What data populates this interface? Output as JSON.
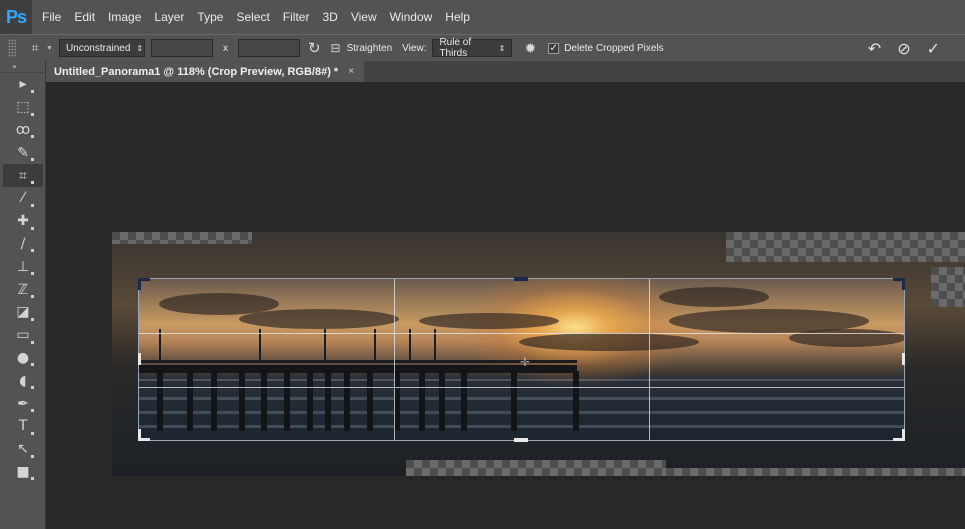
{
  "app": {
    "logo": "Ps"
  },
  "menu": [
    "File",
    "Edit",
    "Image",
    "Layer",
    "Type",
    "Select",
    "Filter",
    "3D",
    "View",
    "Window",
    "Help"
  ],
  "options": {
    "ratio_preset": "Unconstrained",
    "width_value": "",
    "height_value": "",
    "x_label": "x",
    "straighten_label": "Straighten",
    "view_label": "View:",
    "view_value": "Rule of Thirds",
    "delete_cropped_label": "Delete Cropped Pixels",
    "delete_cropped_checked": true
  },
  "document": {
    "tab_title": "Untitled_Panorama1 @ 118% (Crop Preview, RGB/8#) *",
    "close_glyph": "×"
  },
  "tools": [
    {
      "name": "move-tool-icon",
      "glyph": "▸"
    },
    {
      "name": "marquee-tool-icon",
      "glyph": "⬚"
    },
    {
      "name": "lasso-tool-icon",
      "glyph": "ꝏ"
    },
    {
      "name": "quick-selection-tool-icon",
      "glyph": "✎"
    },
    {
      "name": "crop-tool-icon",
      "glyph": "⌗"
    },
    {
      "name": "eyedropper-tool-icon",
      "glyph": "⁄"
    },
    {
      "name": "healing-brush-tool-icon",
      "glyph": "✚"
    },
    {
      "name": "brush-tool-icon",
      "glyph": "∕"
    },
    {
      "name": "clone-stamp-tool-icon",
      "glyph": "⊥"
    },
    {
      "name": "history-brush-tool-icon",
      "glyph": "ℤ"
    },
    {
      "name": "eraser-tool-icon",
      "glyph": "◪"
    },
    {
      "name": "gradient-tool-icon",
      "glyph": "▭"
    },
    {
      "name": "blur-tool-icon",
      "glyph": "●"
    },
    {
      "name": "dodge-tool-icon",
      "glyph": "◖"
    },
    {
      "name": "pen-tool-icon",
      "glyph": "✒"
    },
    {
      "name": "type-tool-icon",
      "glyph": "T"
    },
    {
      "name": "path-selection-tool-icon",
      "glyph": "↖"
    },
    {
      "name": "rectangle-tool-icon",
      "glyph": "■"
    }
  ],
  "colors": {
    "ui_bg": "#535353",
    "canvas_bg": "#282828",
    "ps_blue": "#31a8ff"
  }
}
